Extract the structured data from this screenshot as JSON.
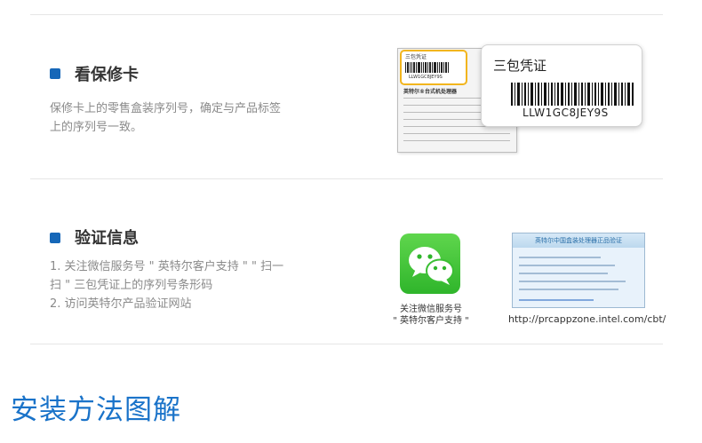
{
  "warranty": {
    "title": "看保修卡",
    "desc_line1": "保修卡上的零售盒装序列号，确定与产品标签",
    "desc_line2": "上的序列号一致。",
    "card_small_title": "三包凭证",
    "card_small_code": "LLW1GC8JEY9S",
    "card_subtitle": "英特尔®台式机处理器",
    "card_front_title": "三包凭证",
    "card_front_code": "LLW1GC8JEY9S"
  },
  "verify": {
    "title": "验证信息",
    "step1_line1": "1. 关注微信服务号 \" 英特尔客户支持 \" \" 扫一",
    "step1_line2": "扫 \" 三包凭证上的序列号条形码",
    "step2": "2. 访问英特尔产品验证网站",
    "wechat_caption1": "关注微信服务号",
    "wechat_caption2": "\" 英特尔客户支持 \"",
    "site_header": "英特尔中国盒装处理器正品验证",
    "site_url": "http://prcappzone.intel.com/cbt/"
  },
  "install": {
    "title": "安装方法图解"
  },
  "colors": {
    "accent_blue": "#1667b8",
    "title_blue": "#1a73c9",
    "highlight_yellow": "#f2b51e",
    "wechat_green": "#3ec138"
  }
}
